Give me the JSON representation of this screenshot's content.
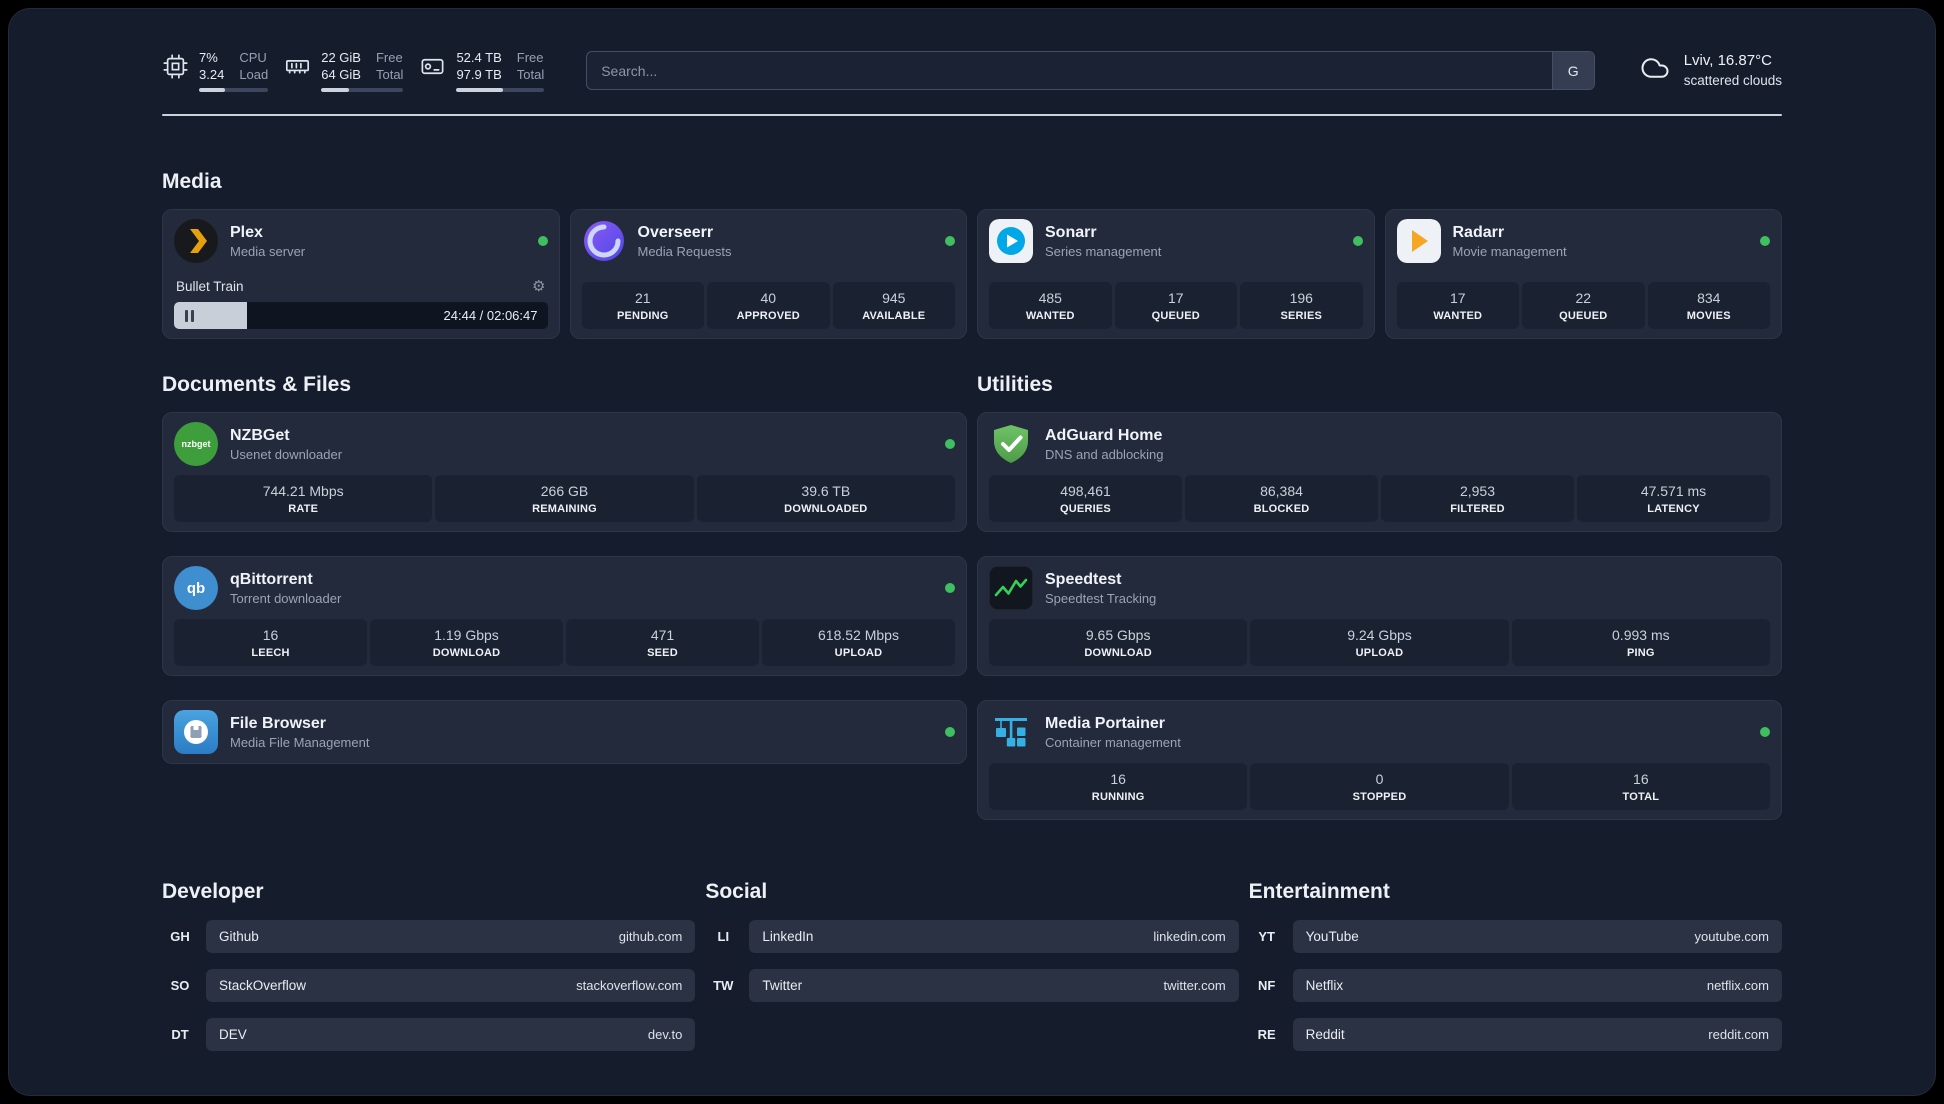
{
  "colors": {
    "status_online": "#3fbf5f",
    "background": "#151c2c",
    "card": "#222a3b",
    "tile": "#1a2231",
    "divider": "#ccd2db"
  },
  "icons": {
    "gear": "⚙"
  },
  "header": {
    "cpu": {
      "value_top": "7%",
      "value_bottom": "3.24",
      "label_top": "CPU",
      "label_bottom": "Load",
      "fill": "38%"
    },
    "ram": {
      "value_top": "22 GiB",
      "value_bottom": "64 GiB",
      "label_top": "Free",
      "label_bottom": "Total",
      "fill": "34%"
    },
    "disk": {
      "value_top": "52.4 TB",
      "value_bottom": "97.9 TB",
      "label_top": "Free",
      "label_bottom": "Total",
      "fill": "53%"
    },
    "search": {
      "placeholder": "Search...",
      "button_label": "G"
    },
    "weather": {
      "location": "Lviv, 16.87°C",
      "condition": "scattered clouds"
    }
  },
  "media": {
    "title": "Media",
    "cards": [
      {
        "name": "Plex",
        "subtitle": "Media server",
        "player": {
          "track": "Bullet Train",
          "time": "24:44 / 02:06:47",
          "progress": "19.5%"
        }
      },
      {
        "name": "Overseerr",
        "subtitle": "Media Requests",
        "stats": [
          {
            "value": "21",
            "label": "PENDING"
          },
          {
            "value": "40",
            "label": "APPROVED"
          },
          {
            "value": "945",
            "label": "AVAILABLE"
          }
        ]
      },
      {
        "name": "Sonarr",
        "subtitle": "Series management",
        "stats": [
          {
            "value": "485",
            "label": "WANTED"
          },
          {
            "value": "17",
            "label": "QUEUED"
          },
          {
            "value": "196",
            "label": "SERIES"
          }
        ]
      },
      {
        "name": "Radarr",
        "subtitle": "Movie management",
        "stats": [
          {
            "value": "17",
            "label": "WANTED"
          },
          {
            "value": "22",
            "label": "QUEUED"
          },
          {
            "value": "834",
            "label": "MOVIES"
          }
        ]
      }
    ]
  },
  "documents": {
    "title": "Documents & Files",
    "cards": [
      {
        "name": "NZBGet",
        "subtitle": "Usenet downloader",
        "icon_text": "nzbget",
        "stats": [
          {
            "value": "744.21 Mbps",
            "label": "RATE"
          },
          {
            "value": "266 GB",
            "label": "REMAINING"
          },
          {
            "value": "39.6 TB",
            "label": "DOWNLOADED"
          }
        ]
      },
      {
        "name": "qBittorrent",
        "subtitle": "Torrent downloader",
        "icon_text": "qb",
        "stats": [
          {
            "value": "16",
            "label": "LEECH"
          },
          {
            "value": "1.19 Gbps",
            "label": "DOWNLOAD"
          },
          {
            "value": "471",
            "label": "SEED"
          },
          {
            "value": "618.52 Mbps",
            "label": "UPLOAD"
          }
        ]
      },
      {
        "name": "File Browser",
        "subtitle": "Media File Management"
      }
    ]
  },
  "utilities": {
    "title": "Utilities",
    "cards": [
      {
        "name": "AdGuard Home",
        "subtitle": "DNS and adblocking",
        "stats": [
          {
            "value": "498,461",
            "label": "QUERIES"
          },
          {
            "value": "86,384",
            "label": "BLOCKED"
          },
          {
            "value": "2,953",
            "label": "FILTERED"
          },
          {
            "value": "47.571 ms",
            "label": "LATENCY"
          }
        ]
      },
      {
        "name": "Speedtest",
        "subtitle": "Speedtest Tracking",
        "stats": [
          {
            "value": "9.65 Gbps",
            "label": "DOWNLOAD"
          },
          {
            "value": "9.24 Gbps",
            "label": "UPLOAD"
          },
          {
            "value": "0.993 ms",
            "label": "PING"
          }
        ]
      },
      {
        "name": "Media Portainer",
        "subtitle": "Container management",
        "stats": [
          {
            "value": "16",
            "label": "RUNNING"
          },
          {
            "value": "0",
            "label": "STOPPED"
          },
          {
            "value": "16",
            "label": "TOTAL"
          }
        ]
      }
    ]
  },
  "bookmarks": {
    "groups": [
      {
        "title": "Developer",
        "items": [
          {
            "abbr": "GH",
            "name": "Github",
            "url": "github.com"
          },
          {
            "abbr": "SO",
            "name": "StackOverflow",
            "url": "stackoverflow.com"
          },
          {
            "abbr": "DT",
            "name": "DEV",
            "url": "dev.to"
          }
        ]
      },
      {
        "title": "Social",
        "items": [
          {
            "abbr": "LI",
            "name": "LinkedIn",
            "url": "linkedin.com"
          },
          {
            "abbr": "TW",
            "name": "Twitter",
            "url": "twitter.com"
          }
        ]
      },
      {
        "title": "Entertainment",
        "items": [
          {
            "abbr": "YT",
            "name": "YouTube",
            "url": "youtube.com"
          },
          {
            "abbr": "NF",
            "name": "Netflix",
            "url": "netflix.com"
          },
          {
            "abbr": "RE",
            "name": "Reddit",
            "url": "reddit.com"
          }
        ]
      }
    ]
  }
}
